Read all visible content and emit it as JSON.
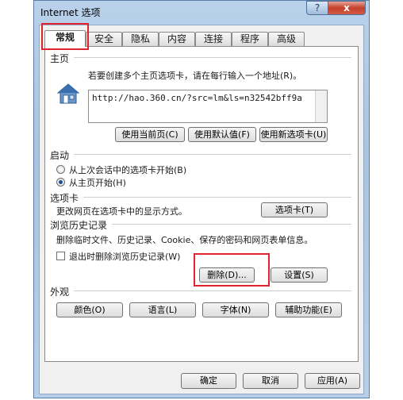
{
  "window": {
    "title": "Internet 选项",
    "help_label": "?",
    "close_label": "x"
  },
  "tabs": [
    {
      "label": "常规",
      "active": true
    },
    {
      "label": "安全"
    },
    {
      "label": "隐私"
    },
    {
      "label": "内容"
    },
    {
      "label": "连接"
    },
    {
      "label": "程序"
    },
    {
      "label": "高级"
    }
  ],
  "home": {
    "title": "主页",
    "description": "若要创建多个主页选项卡，请在每行输入一个地址(R)。",
    "url": "http://hao.360.cn/?src=lm&ls=n32542bff9a",
    "use_current": "使用当前页(C)",
    "use_default": "使用默认值(F)",
    "use_new_tab": "使用新选项卡(U)"
  },
  "startup": {
    "title": "启动",
    "option_last_session": "从上次会话中的选项卡开始(B)",
    "option_home": "从主页开始(H)"
  },
  "tabs_section": {
    "title": "选项卡",
    "description": "更改网页在选项卡中的显示方式。",
    "button": "选项卡(T)"
  },
  "history": {
    "title": "浏览历史记录",
    "description": "删除临时文件、历史记录、Cookie、保存的密码和网页表单信息。",
    "delete_on_exit": "退出时删除浏览历史记录(W)",
    "delete_button": "删除(D)...",
    "settings_button": "设置(S)"
  },
  "appearance": {
    "title": "外观",
    "colors": "颜色(O)",
    "languages": "语言(L)",
    "fonts": "字体(N)",
    "accessibility": "辅助功能(E)"
  },
  "footer": {
    "ok": "确定",
    "cancel": "取消",
    "apply": "应用(A)"
  },
  "colors": {
    "highlight": "#e0232e",
    "titlebar": "#b9d1ea",
    "radio_dot": "#1f4f8f"
  }
}
